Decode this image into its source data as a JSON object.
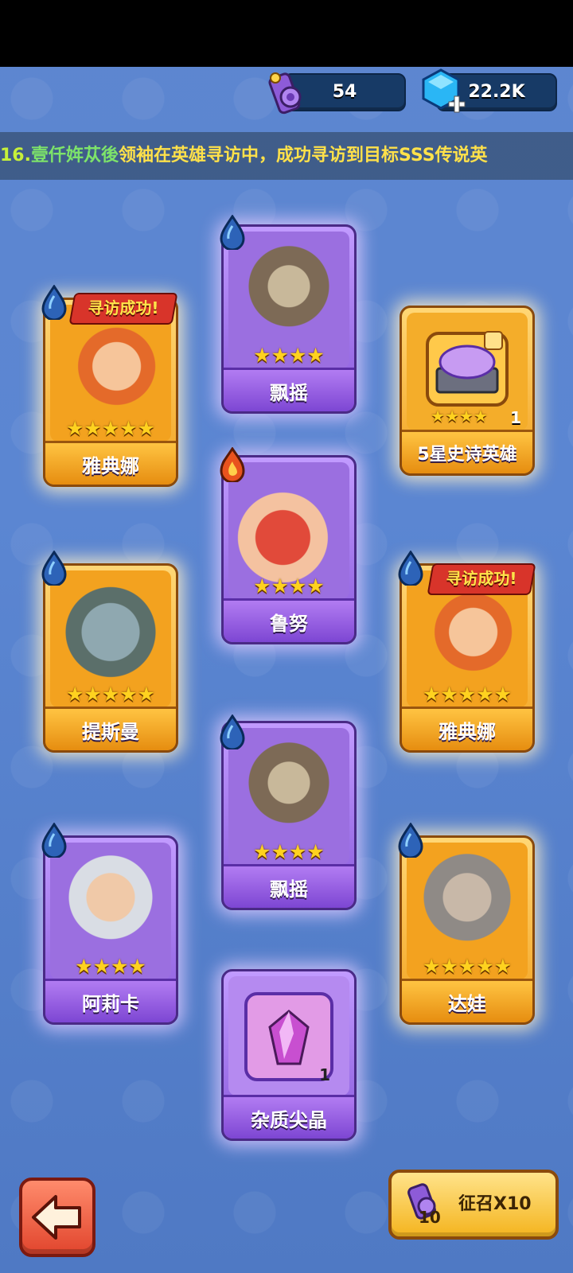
{
  "currency": {
    "scrolls": "54",
    "gems": "22.2K"
  },
  "ticker": {
    "number": "16.",
    "player": "壹仟姩苁後",
    "message": "领袖在英雄寻访中，成功寻访到目标SSS传说英"
  },
  "cards": [
    {
      "name": "雅典娜",
      "stars": "★★★★★",
      "rarity": "legend",
      "element": "water",
      "badge": "寻访成功!"
    },
    {
      "name": "飘摇",
      "stars": "★★★★",
      "rarity": "epic",
      "element": "water"
    },
    {
      "name": "5星史诗英雄",
      "stars": "★★★★",
      "rarity": "legend",
      "count": "1"
    },
    {
      "name": "提斯曼",
      "stars": "★★★★★",
      "rarity": "legend",
      "element": "water"
    },
    {
      "name": "鲁努",
      "stars": "★★★★",
      "rarity": "epic",
      "element": "fire"
    },
    {
      "name": "雅典娜",
      "stars": "★★★★★",
      "rarity": "legend",
      "element": "water",
      "badge": "寻访成功!"
    },
    {
      "name": "飘摇",
      "stars": "★★★★",
      "rarity": "epic",
      "element": "water"
    },
    {
      "name": "阿莉卡",
      "stars": "★★★★",
      "rarity": "epic",
      "element": "water"
    },
    {
      "name": "达娃",
      "stars": "★★★★★",
      "rarity": "legend",
      "element": "water"
    },
    {
      "name": "杂质尖晶",
      "rarity": "epic",
      "count": "1"
    }
  ],
  "buttons": {
    "summon_label": "征召X10",
    "summon_cost": "10"
  },
  "colors": {
    "background": "#5b86d2",
    "epic": "#8a5bdc",
    "legend": "#f3a21f"
  }
}
